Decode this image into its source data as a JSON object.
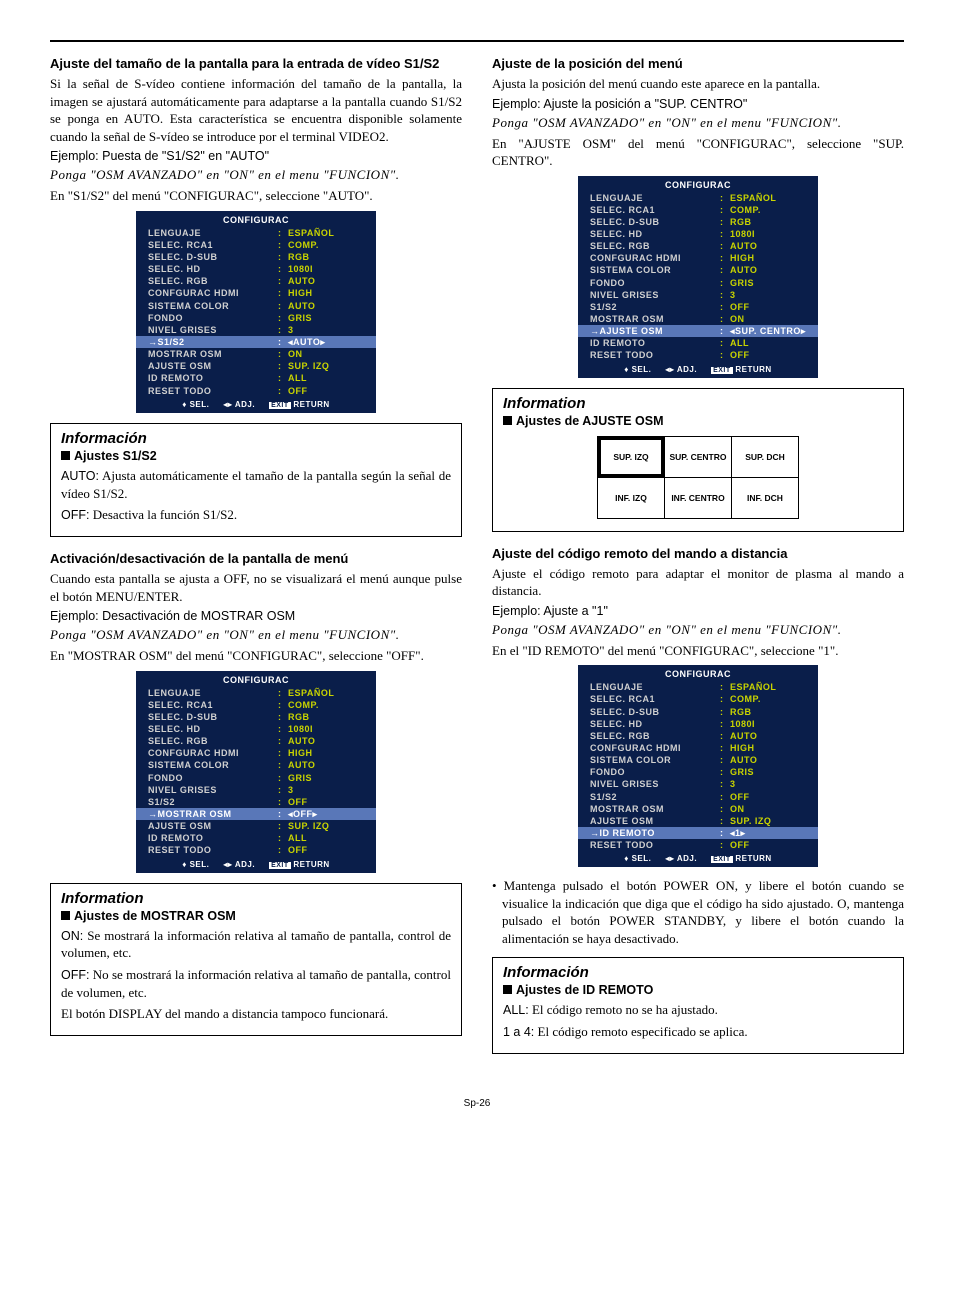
{
  "menu": {
    "title": "CONFIGURAC",
    "rows": [
      {
        "label": "LENGUAJE",
        "val": "ESPAÑOL"
      },
      {
        "label": "SELEC. RCA1",
        "val": "COMP."
      },
      {
        "label": "SELEC. D-SUB",
        "val": "RGB"
      },
      {
        "label": "SELEC. HD",
        "val": "1080I"
      },
      {
        "label": "SELEC. RGB",
        "val": "AUTO"
      },
      {
        "label": "CONFGURAC HDMI",
        "val": "HIGH"
      },
      {
        "label": "SISTEMA COLOR",
        "val": "AUTO"
      },
      {
        "label": "FONDO",
        "val": "GRIS"
      },
      {
        "label": "NIVEL GRISES",
        "val": "3"
      },
      {
        "label": "S1/S2",
        "val": "AUTO",
        "hl": true,
        "arrows": true
      },
      {
        "label": "MOSTRAR OSM",
        "val": "ON"
      },
      {
        "label": "AJUSTE OSM",
        "val": "SUP. IZQ"
      },
      {
        "label": "ID REMOTO",
        "val": "ALL"
      },
      {
        "label": "RESET TODO",
        "val": "OFF"
      }
    ],
    "foot": {
      "sel": "SEL.",
      "adj": "ADJ.",
      "ret": "RETURN",
      "exit": "EXIT"
    }
  },
  "menu2": {
    "rows": [
      {
        "label": "LENGUAJE",
        "val": "ESPAÑOL"
      },
      {
        "label": "SELEC. RCA1",
        "val": "COMP."
      },
      {
        "label": "SELEC. D-SUB",
        "val": "RGB"
      },
      {
        "label": "SELEC. HD",
        "val": "1080I"
      },
      {
        "label": "SELEC. RGB",
        "val": "AUTO"
      },
      {
        "label": "CONFGURAC HDMI",
        "val": "HIGH"
      },
      {
        "label": "SISTEMA COLOR",
        "val": "AUTO"
      },
      {
        "label": "FONDO",
        "val": "GRIS"
      },
      {
        "label": "NIVEL GRISES",
        "val": "3"
      },
      {
        "label": "S1/S2",
        "val": "OFF"
      },
      {
        "label": "MOSTRAR OSM",
        "val": "OFF",
        "hl": true,
        "arrows": true
      },
      {
        "label": "AJUSTE OSM",
        "val": "SUP. IZQ"
      },
      {
        "label": "ID REMOTO",
        "val": "ALL"
      },
      {
        "label": "RESET TODO",
        "val": "OFF"
      }
    ]
  },
  "menu3": {
    "rows": [
      {
        "label": "LENGUAJE",
        "val": "ESPAÑOL"
      },
      {
        "label": "SELEC. RCA1",
        "val": "COMP."
      },
      {
        "label": "SELEC. D-SUB",
        "val": "RGB"
      },
      {
        "label": "SELEC. HD",
        "val": "1080I"
      },
      {
        "label": "SELEC. RGB",
        "val": "AUTO"
      },
      {
        "label": "CONFGURAC HDMI",
        "val": "HIGH"
      },
      {
        "label": "SISTEMA COLOR",
        "val": "AUTO"
      },
      {
        "label": "FONDO",
        "val": "GRIS"
      },
      {
        "label": "NIVEL GRISES",
        "val": "3"
      },
      {
        "label": "S1/S2",
        "val": "OFF"
      },
      {
        "label": "MOSTRAR OSM",
        "val": "ON"
      },
      {
        "label": "AJUSTE OSM",
        "val": "SUP. CENTRO",
        "hl": true,
        "arrows": true
      },
      {
        "label": "ID REMOTO",
        "val": "ALL"
      },
      {
        "label": "RESET TODO",
        "val": "OFF"
      }
    ]
  },
  "menu4": {
    "rows": [
      {
        "label": "LENGUAJE",
        "val": "ESPAÑOL"
      },
      {
        "label": "SELEC. RCA1",
        "val": "COMP."
      },
      {
        "label": "SELEC. D-SUB",
        "val": "RGB"
      },
      {
        "label": "SELEC. HD",
        "val": "1080I"
      },
      {
        "label": "SELEC. RGB",
        "val": "AUTO"
      },
      {
        "label": "CONFGURAC HDMI",
        "val": "HIGH"
      },
      {
        "label": "SISTEMA COLOR",
        "val": "AUTO"
      },
      {
        "label": "FONDO",
        "val": "GRIS"
      },
      {
        "label": "NIVEL GRISES",
        "val": "3"
      },
      {
        "label": "S1/S2",
        "val": "OFF"
      },
      {
        "label": "MOSTRAR OSM",
        "val": "ON"
      },
      {
        "label": "AJUSTE OSM",
        "val": "SUP. IZQ"
      },
      {
        "label": "ID REMOTO",
        "val": "1",
        "hl": true,
        "arrows": true
      },
      {
        "label": "RESET TODO",
        "val": "OFF"
      }
    ]
  },
  "left": {
    "h1": "Ajuste del tamaño de la pantalla para la entrada de vídeo S1/S2",
    "p1": "Si la señal de S-vídeo contiene información del tamaño de la pantalla, la imagen se ajustará automáticamente para adaptarse a la pantalla cuando S1/S2 se ponga en AUTO. Esta característica se encuentra disponible solamente cuando la señal de S-vídeo se introduce por el terminal VIDEO2.",
    "ex1": "Ejemplo: Puesta de \"S1/S2\" en \"AUTO\"",
    "it1": "Ponga \"OSM AVANZADO\" en \"ON\" en el menu \"FUNCION\".",
    "p2": "En \"S1/S2\" del menú \"CONFIGURAC\", seleccione \"AUTO\".",
    "info1_head": "Información",
    "info1_sub": "Ajustes S1/S2",
    "info1_l1a": "AUTO:",
    "info1_l1b": " Ajusta automáticamente el tamaño de la pantalla según la señal de vídeo S1/S2.",
    "info1_l2a": "OFF:",
    "info1_l2b": " Desactiva la función S1/S2.",
    "h2": "Activación/desactivación de la pantalla de menú",
    "p3": "Cuando esta pantalla se ajusta a OFF, no se visualizará el menú aunque pulse el botón MENU/ENTER.",
    "ex2": "Ejemplo: Desactivación de MOSTRAR OSM",
    "p4": "En \"MOSTRAR OSM\" del menú \"CONFIGURAC\", seleccione \"OFF\".",
    "info2_head": "Information",
    "info2_sub": "Ajustes de MOSTRAR OSM",
    "info2_l1a": "ON:",
    "info2_l1b": " Se mostrará la información relativa al tamaño de pantalla, control de volumen, etc.",
    "info2_l2a": "OFF:",
    "info2_l2b": " No se mostrará la información relativa al tamaño de pantalla, control de volumen, etc.",
    "info2_l3": "El botón DISPLAY del mando a distancia tampoco funcionará."
  },
  "right": {
    "h1": "Ajuste de la posición del menú",
    "p1": "Ajusta la posición del menú cuando este aparece en la pantalla.",
    "ex1": "Ejemplo: Ajuste la posición a \"SUP. CENTRO\"",
    "p2": "En \"AJUSTE OSM\" del menú \"CONFIGURAC\", seleccione \"SUP. CENTRO\".",
    "info1_head": "Information",
    "info1_sub": "Ajustes de AJUSTE OSM",
    "pos": [
      [
        "SUP. IZQ",
        "SUP. CENTRO",
        "SUP. DCH"
      ],
      [
        "INF. IZQ",
        "INF. CENTRO",
        "INF. DCH"
      ]
    ],
    "h2": "Ajuste del código remoto del mando a distancia",
    "p3": "Ajuste el código remoto para adaptar el monitor de plasma al mando a distancia.",
    "ex2": "Ejemplo: Ajuste a \"1\"",
    "p4": "En el \"ID REMOTO\" del menú \"CONFIGURAC\", seleccione \"1\".",
    "bullet": "• Mantenga pulsado el botón POWER ON, y libere el botón cuando se visualice la indicación que diga que el código ha sido ajustado. O, mantenga pulsado el botón POWER STANDBY, y libere el botón cuando la alimentación se haya desactivado.",
    "info2_head": "Información",
    "info2_sub": "Ajustes de ID REMOTO",
    "info2_l1a": "ALL:",
    "info2_l1b": " El código remoto no se ha ajustado.",
    "info2_l2a": "1 a 4:",
    "info2_l2b": " El código remoto especificado se aplica."
  },
  "pagenum": "Sp-26"
}
